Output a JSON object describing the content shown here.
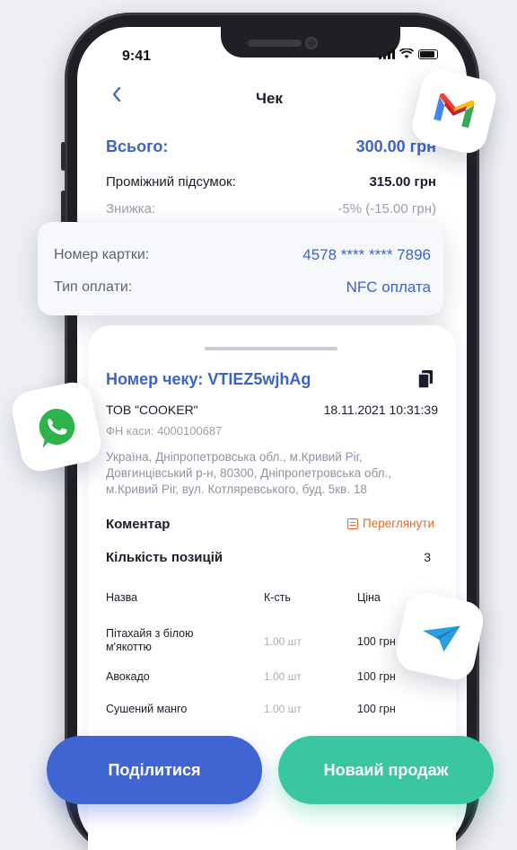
{
  "status_bar": {
    "time": "9:41"
  },
  "header": {
    "back_icon": "chevron-left-icon",
    "title": "Чек"
  },
  "summary": {
    "total_label": "Всього:",
    "total_value": "300.00 грн",
    "subtotal_label": "Проміжний підсумок:",
    "subtotal_value": "315.00 грн",
    "discount_label": "Знижка:",
    "discount_value": "-5% (-15.00 грн)"
  },
  "payment": {
    "card_label": "Номер картки:",
    "card_value": "4578 **** **** 7896",
    "type_label": "Тип оплати:",
    "type_value": "NFC оплата"
  },
  "receipt": {
    "title": "Номер чеку: VTIEZ5wjhAg",
    "company": "ТОВ \"COOKER\"",
    "datetime": "18.11.2021 10:31:39",
    "fn": "ФН каси: 4000100687",
    "address": "Україна, Дніпропетровська обл., м.Кривий Ріг, Довгинцівський р-н, 80300, Дніпропетровська обл., м.Кривий Ріг, вул. Котляревського, буд. 5кв. 18",
    "comment_label": "Коментар",
    "view_label": "Переглянути",
    "count_label": "Кількість позицій",
    "count_value": "3",
    "columns": [
      "Назва",
      "К-сть",
      "Ціна"
    ],
    "items": [
      {
        "name": "Пітахайя з білою м'якоттю",
        "qty": "1.00 шт",
        "price": "100 грн"
      },
      {
        "name": "Авокадо",
        "qty": "1.00 шт",
        "price": "100 грн"
      },
      {
        "name": "Сушений манго",
        "qty": "1.00 шт",
        "price": "100 грн"
      }
    ]
  },
  "actions": {
    "share_label": "Поділитися",
    "new_sale_label": "Новаий продаж"
  },
  "share_apps": [
    "gmail-icon",
    "whatsapp-icon",
    "telegram-icon"
  ],
  "colors": {
    "accent": "#3d63c8",
    "share_button": "#4065d2",
    "new_sale_button": "#39c6a0",
    "view_link": "#e86a2c"
  }
}
